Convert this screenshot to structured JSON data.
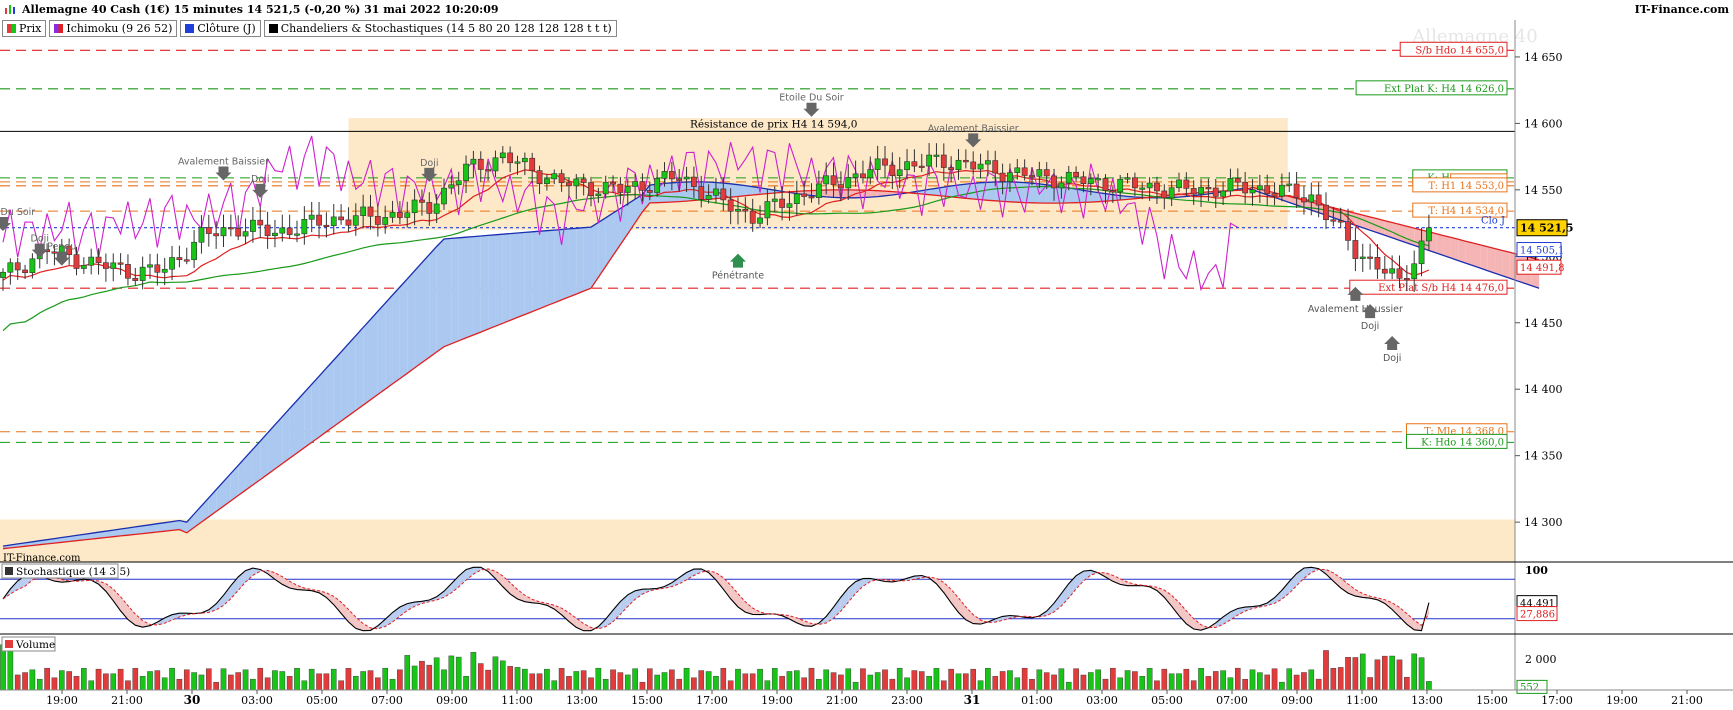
{
  "header": {
    "title": "Allemagne 40 Cash (1€) 15 minutes 14 521,5 (-0,20 %) 31 mai 2022 10:20:09",
    "brand": "IT-Finance.com",
    "watermark": "Allemagne 40",
    "panel_credit": "IT-Finance.com"
  },
  "legend": [
    {
      "label": "Prix",
      "color": "#2e8b57"
    },
    {
      "label": "Ichimoku (9 26 52)",
      "color": "#8a2be2"
    },
    {
      "label": "Clôture (J)",
      "color": "#1f3fd6"
    },
    {
      "label": "Chandeliers & Stochastiques (14 5 80 20 128 128 128 t t t)",
      "color": "#000000"
    }
  ],
  "subpanels": {
    "stoch_label": "Stochastique (14 3 5)",
    "volume_label": "Volume"
  },
  "colors": {
    "up": "#17c417",
    "down": "#e23b3b",
    "tenkan": "#e02020",
    "kijun": "#1a9a1a",
    "chikou": "#cc22cc",
    "cloud_bull": "#aac8f0",
    "cloud_bear": "#f5b5b5",
    "zone": "#fde9c8",
    "senkou_a": "#1a2fb0",
    "senkou_b": "#e02020"
  },
  "chart_data": [
    {
      "type": "line",
      "title": "Allemagne 40 Cash (1€) 15 minutes",
      "ylim": [
        14270,
        14665
      ],
      "y_ticks": [
        "14 650",
        "14 600",
        "14 550",
        "14 500",
        "14 450",
        "14 400",
        "14 350",
        "14 300"
      ],
      "x_ticks": [
        "19:00",
        "21:00",
        "30",
        "03:00",
        "05:00",
        "07:00",
        "09:00",
        "11:00",
        "13:00",
        "15:00",
        "17:00",
        "19:00",
        "21:00",
        "23:00",
        "31",
        "01:00",
        "03:00",
        "05:00",
        "07:00",
        "09:00",
        "11:00",
        "13:00",
        "15:00",
        "17:00",
        "19:00",
        "21:00"
      ],
      "last_price": {
        "label": "14 521,5",
        "value": 14521.5
      },
      "right_labels": [
        {
          "label": "14 505,1",
          "value": 14505.1,
          "color": "#1f3fd6"
        },
        {
          "label": "14 491,8",
          "value": 14491.8,
          "color": "#e02020"
        }
      ],
      "levels": [
        {
          "label": "S/b Hdo 14 655,0",
          "value": 14655.0,
          "color": "#e02020",
          "style": "dashed"
        },
        {
          "label": "Ext Plat K: H4 14 626,0",
          "value": 14626.0,
          "color": "#1a9a1a",
          "style": "dashed"
        },
        {
          "label": "Résistance de prix H4 14 594,0",
          "value": 14594.0,
          "color": "#000000",
          "style": "solid"
        },
        {
          "label": "K: H1 14 559,0",
          "value": 14559.0,
          "color": "#1a9a1a",
          "style": "dashed"
        },
        {
          "label": "Ext Plat",
          "value": 14556.0,
          "color": "#e8741a",
          "style": "dashed"
        },
        {
          "label": "T: H1 14 553,0",
          "value": 14553.0,
          "color": "#e8741a",
          "style": "dashed"
        },
        {
          "label": "T: H4 14 534,0",
          "value": 14534.0,
          "color": "#e8741a",
          "style": "dashed"
        },
        {
          "label": "Ext Plat S/b H4 14 476,0",
          "value": 14476.0,
          "color": "#e02020",
          "style": "dashed"
        },
        {
          "label": "T: Mle 14 368,0",
          "value": 14368.0,
          "color": "#e8741a",
          "style": "dashed"
        },
        {
          "label": "K: Hdo 14 360,0",
          "value": 14360.0,
          "color": "#1a9a1a",
          "style": "dashed"
        },
        {
          "label": "Clo J",
          "value": 14521.5,
          "color": "#1f3fd6",
          "style": "dotted"
        }
      ],
      "zones": [
        {
          "from": 14520,
          "to": 14604,
          "x_start": 0.23,
          "x_end": 0.85
        },
        {
          "from": 14270,
          "to": 14302,
          "x_start": 0,
          "x_end": 1
        }
      ],
      "annotations": [
        {
          "label": "Etoile Du Soir",
          "bar": 0,
          "value": 14519,
          "dir": "down"
        },
        {
          "label": "Doji",
          "bar": 5,
          "value": 14499,
          "dir": "down"
        },
        {
          "label": "Pendu",
          "bar": 8,
          "value": 14493,
          "dir": "down"
        },
        {
          "label": "Avalement Baissier",
          "bar": 30,
          "value": 14557,
          "dir": "down"
        },
        {
          "label": "Doji",
          "bar": 35,
          "value": 14544,
          "dir": "down"
        },
        {
          "label": "Doji",
          "bar": 58,
          "value": 14556,
          "dir": "down"
        },
        {
          "label": "Etoile Du Soir",
          "bar": 110,
          "value": 14605,
          "dir": "down"
        },
        {
          "label": "Avalement Baissier",
          "bar": 132,
          "value": 14582,
          "dir": "down"
        },
        {
          "label": "Pénétrante",
          "bar": 100,
          "value": 14502,
          "dir": "up"
        },
        {
          "label": "Avalement Haussier",
          "bar": 184,
          "value": 14477,
          "dir": "up"
        },
        {
          "label": "Doji",
          "bar": 186,
          "value": 14464,
          "dir": "up"
        },
        {
          "label": "Doji",
          "bar": 189,
          "value": 14440,
          "dir": "up"
        }
      ]
    },
    {
      "type": "line",
      "title": "Stochastique (14 3 5)",
      "ylim": [
        0,
        100
      ],
      "levels": [
        {
          "label": "80",
          "value": 80
        },
        {
          "label": "20",
          "value": 20
        }
      ],
      "y_ticks": [
        "100"
      ],
      "last_values": [
        {
          "label": "44,491",
          "value": 44.491,
          "color": "#000000"
        },
        {
          "label": "27,886",
          "value": 27.886,
          "color": "#e02020"
        }
      ]
    },
    {
      "type": "bar",
      "title": "Volume",
      "y_ticks": [
        "2 000"
      ],
      "last_value": {
        "label": "552",
        "value": 552
      }
    }
  ]
}
